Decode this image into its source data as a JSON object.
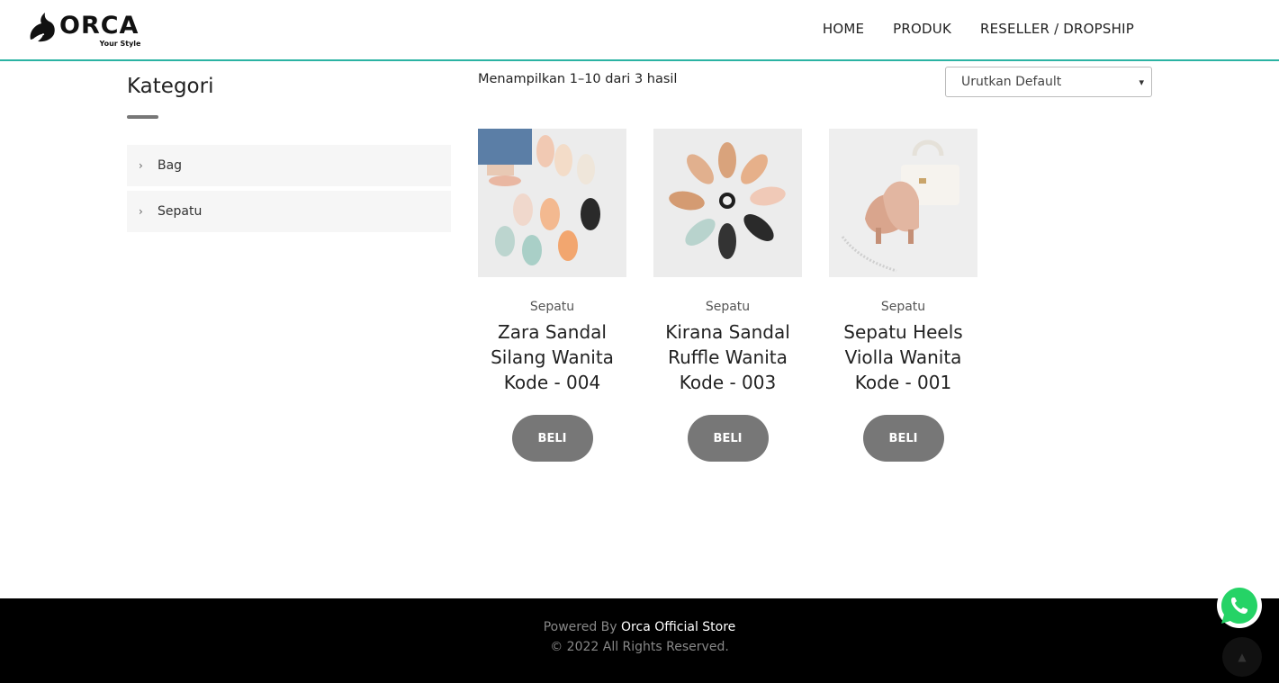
{
  "header": {
    "logo": {
      "word": "ORCA",
      "tagline": "Your Style"
    },
    "nav": [
      "HOME",
      "PRODUK",
      "RESELLER / DROPSHIP"
    ]
  },
  "sidebar": {
    "title": "Kategori",
    "items": [
      {
        "label": "Bag"
      },
      {
        "label": "Sepatu"
      }
    ]
  },
  "results": {
    "summary": "Menampilkan 1–10 dari 3 hasil",
    "sort_selected": "Urutkan Default"
  },
  "products": [
    {
      "category": "Sepatu",
      "name": "Zara Sandal Silang Wanita Kode - 004",
      "button": "BELI"
    },
    {
      "category": "Sepatu",
      "name": "Kirana Sandal Ruffle Wanita Kode - 003",
      "button": "BELI"
    },
    {
      "category": "Sepatu",
      "name": "Sepatu Heels Violla Wanita Kode - 001",
      "button": "BELI"
    }
  ],
  "footer": {
    "powered_prefix": "Powered By",
    "powered_brand": "Orca Official Store",
    "copyright": "© 2022 All Rights Reserved."
  },
  "colors": {
    "accent_teal": "#2bb3a3",
    "button_gray": "#777777",
    "whatsapp_green": "#25d366"
  },
  "icons": [
    "orca-logo-icon",
    "chevron-right-icon",
    "chevron-down-icon",
    "whatsapp-icon",
    "chevron-up-icon"
  ]
}
